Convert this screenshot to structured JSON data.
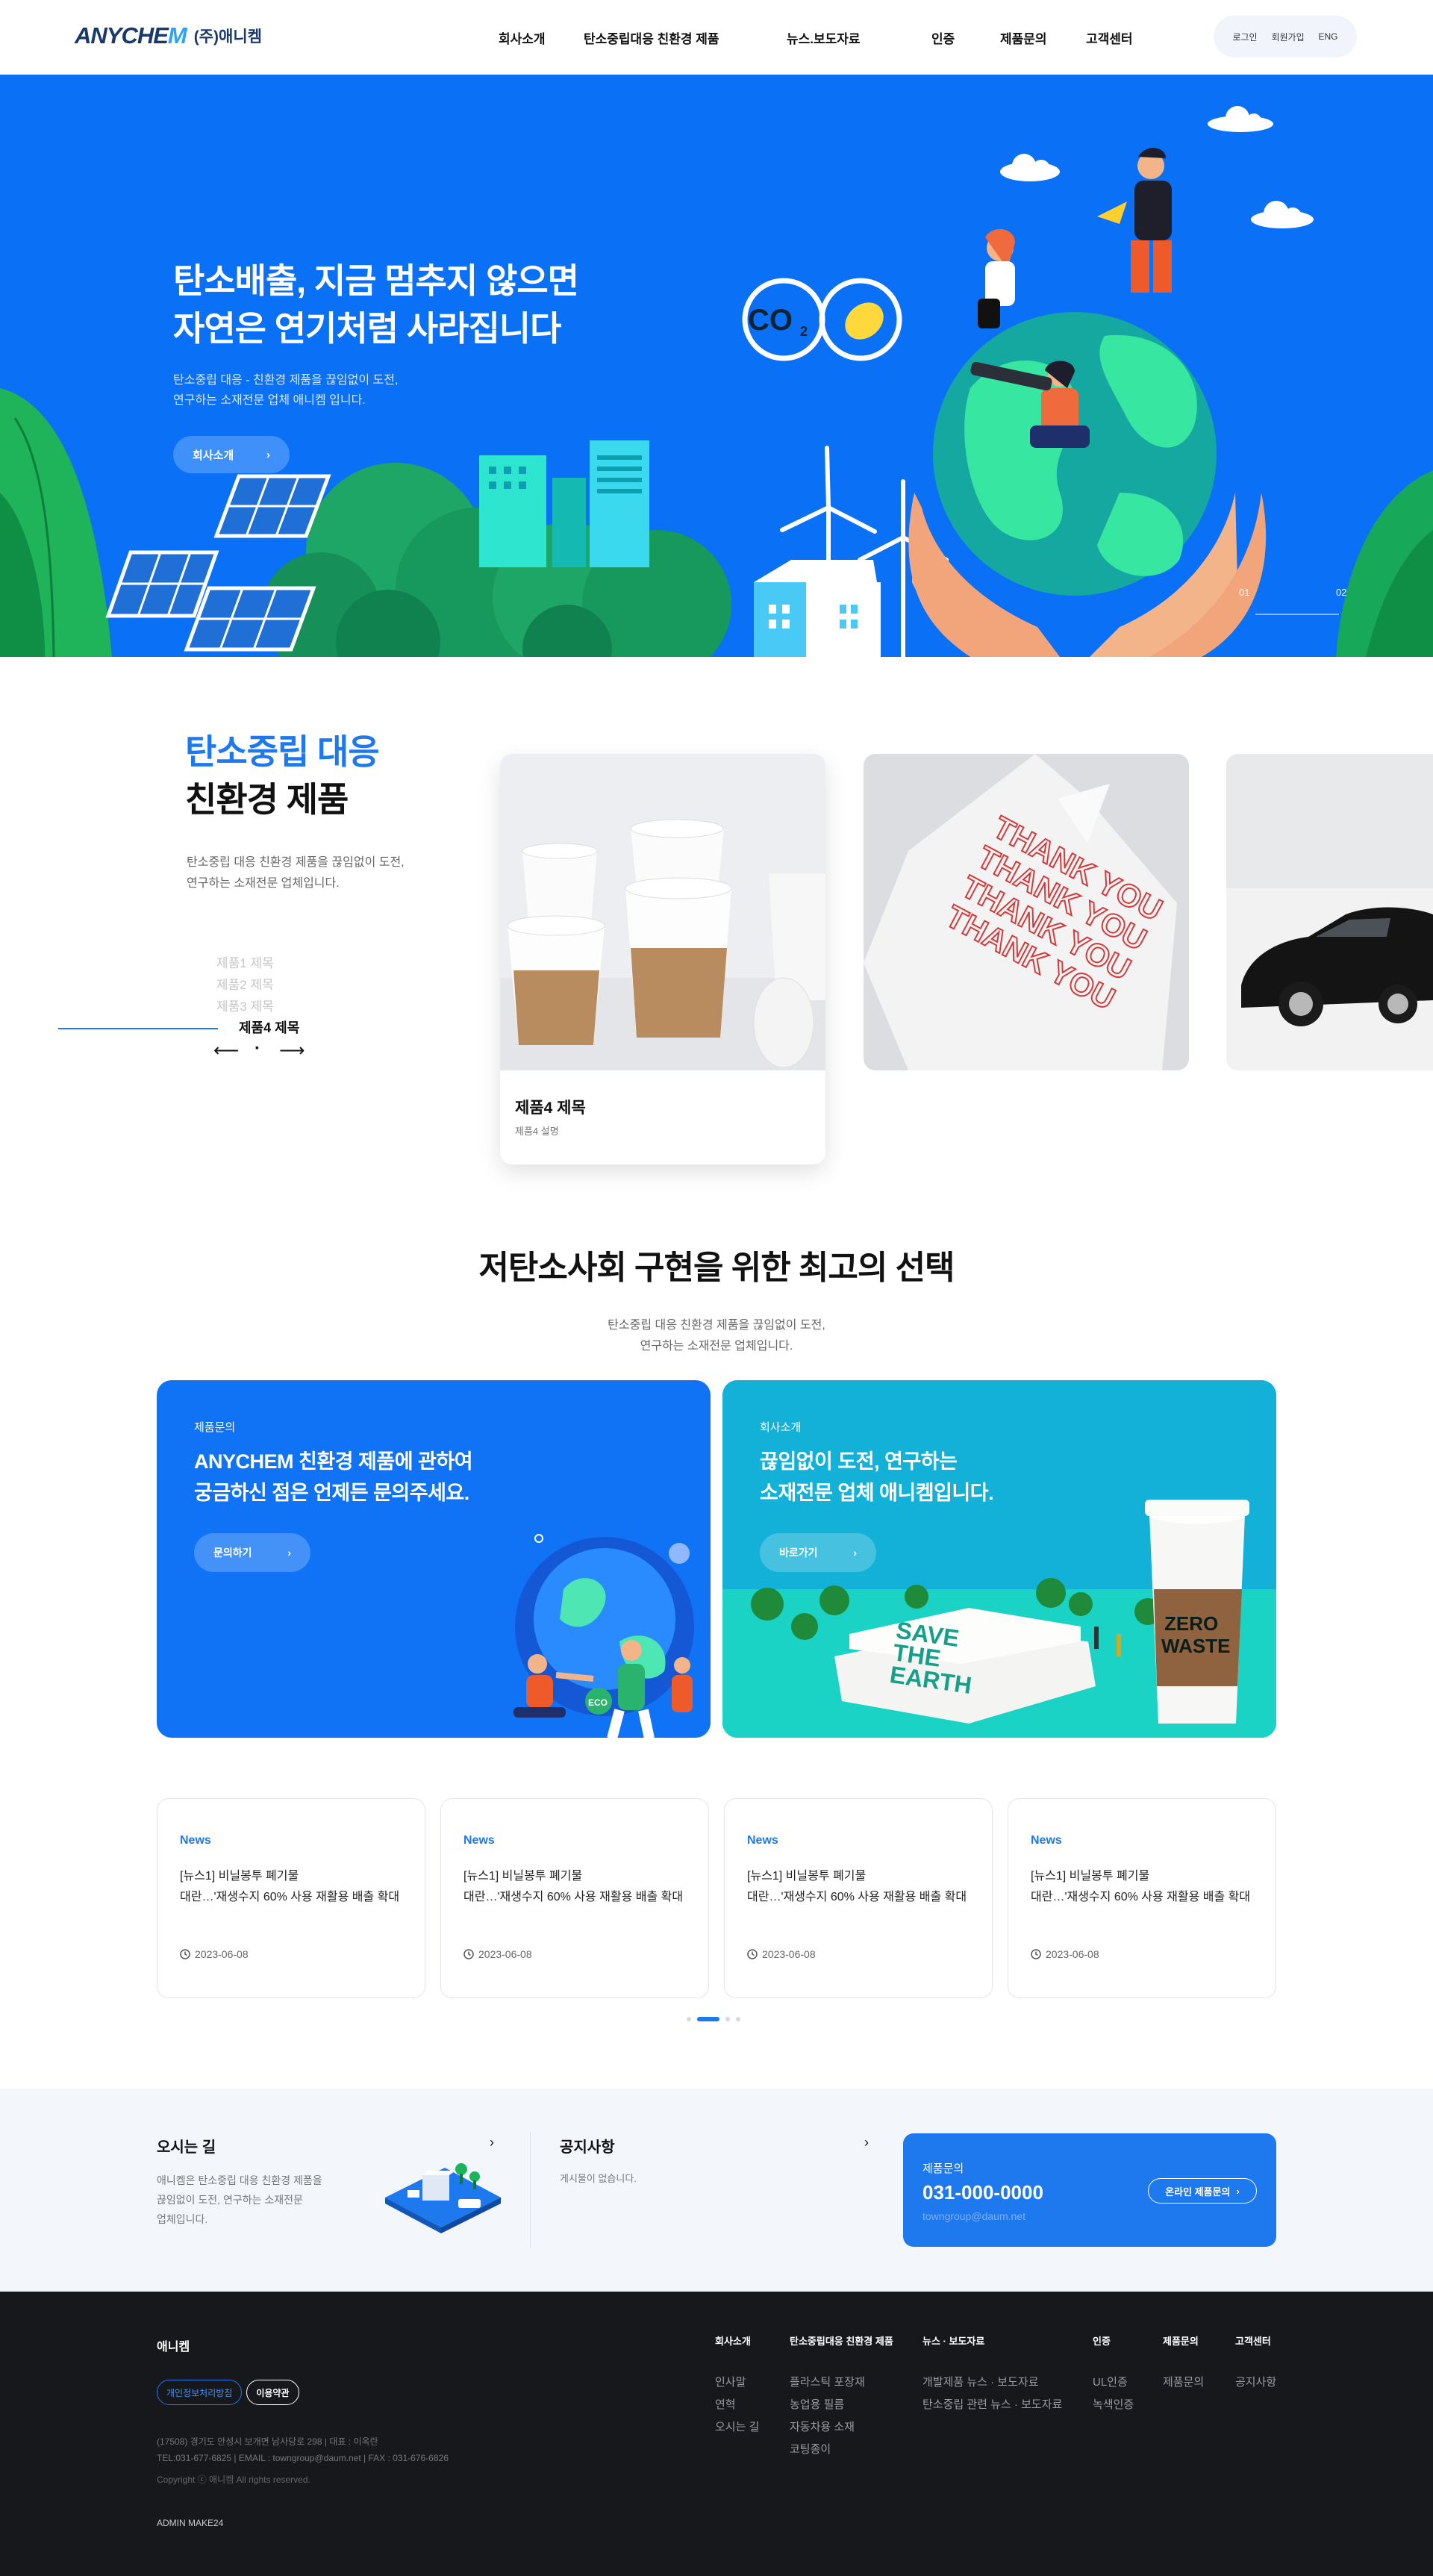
{
  "header": {
    "logo_en_a": "ANYCHE",
    "logo_en_b": "M",
    "logo_ko": "(주)애니켐",
    "nav": [
      "회사소개",
      "탄소중립대응 친환경 제품",
      "뉴스.보도자료",
      "인증",
      "제품문의",
      "고객센터"
    ],
    "util": [
      "로그인",
      "회원가입",
      "ENG"
    ]
  },
  "hero": {
    "title_line1": "탄소배출, 지금 멈추지 않으면",
    "title_line2": "자연은 연기처럼 사라집니다",
    "sub_line1": "탄소중립 대응 - 친환경 제품을 끊임없이 도전,",
    "sub_line2": "연구하는 소재전문 업체 애니켐 입니다.",
    "button": "회사소개",
    "co2_label": "CO",
    "co2_sub": "2",
    "pager": [
      "01",
      "02"
    ]
  },
  "products": {
    "title_blue": "탄소중립 대응",
    "title_black": "친환경 제품",
    "desc_line1": "탄소중립 대응 친환경 제품을 끊임없이 도전,",
    "desc_line2": "연구하는 소재전문 업체입니다.",
    "list": [
      "제품1 제목",
      "제품2 제목",
      "제품3 제목",
      "제품4 제목"
    ],
    "active_card_title": "제품4 제목",
    "active_card_sub": "제품4 설명",
    "bag_text": "THANK YOU"
  },
  "choice": {
    "title": "저탄소사회 구현을 위한 최고의 선택",
    "desc_line1": "탄소중립 대응 친환경 제품을 끊임없이 도전,",
    "desc_line2": "연구하는 소재전문 업체입니다.",
    "left": {
      "label": "제품문의",
      "title_line1": "ANYCHEM 친환경 제품에 관하여",
      "title_line2": "궁금하신 점은 언제든 문의주세요.",
      "button": "문의하기",
      "eco": "ECO"
    },
    "right": {
      "label": "회사소개",
      "title_line1": "끊임없이 도전, 연구하는",
      "title_line2": "소재전문 업체 애니켐입니다.",
      "button": "바로가기",
      "box_text": [
        "SAVE",
        "THE",
        "EARTH"
      ],
      "cup_text": [
        "ZERO",
        "WASTE"
      ]
    }
  },
  "news": [
    {
      "tag": "News",
      "line1": "[뉴스1] 비닐봉투 폐기물",
      "line2": "대란…'재생수지 60% 사용 재활용 배출 확대",
      "date": "2023-06-08"
    },
    {
      "tag": "News",
      "line1": "[뉴스1] 비닐봉투 폐기물",
      "line2": "대란…'재생수지 60% 사용 재활용 배출 확대",
      "date": "2023-06-08"
    },
    {
      "tag": "News",
      "line1": "[뉴스1] 비닐봉투 폐기물",
      "line2": "대란…'재생수지 60% 사용 재활용 배출 확대",
      "date": "2023-06-08"
    },
    {
      "tag": "News",
      "line1": "[뉴스1] 비닐봉투 폐기물",
      "line2": "대란…'재생수지 60% 사용 재활용 배출 확대",
      "date": "2023-06-08"
    }
  ],
  "info": {
    "way_title": "오시는 길",
    "way_desc_line1": "애니켐은 탄소중립 대응 친환경 제품을",
    "way_desc_line2": "끊임없이 도전, 연구하는 소재전문",
    "way_desc_line3": "업체입니다.",
    "notice_title": "공지사항",
    "notice_empty": "게시물이 없습니다.",
    "cs_label": "제품문의",
    "cs_phone": "031-000-0000",
    "cs_email": "towngroup@daum.net",
    "cs_button": "온라인 제품문의"
  },
  "footer": {
    "name": "애니켐",
    "pill1": "개인정보처리방침",
    "pill2": "이용약관",
    "addr_line1": "(17508) 경기도 안성시 보개면 남사당로 298  |  대표 : 이옥란",
    "addr_line2": "TEL:031-677-6825  |  EMAIL : towngroup@daum.net  |  FAX : 031-676-6826",
    "copyright": "Copyright ⓒ 애니켐 All rights reserved.",
    "admin": "ADMIN MAKE24",
    "cols": [
      {
        "head": "회사소개",
        "items": [
          "인사말",
          "연혁",
          "오시는 길"
        ]
      },
      {
        "head": "탄소중립대응 친환경 제품",
        "items": [
          "플라스틱 포장재",
          "농업용 필름",
          "자동차용 소재",
          "코팅종이"
        ]
      },
      {
        "head": "뉴스 · 보도자료",
        "items": [
          "개발제품 뉴스 · 보도자료",
          "탄소중립 관련 뉴스 · 보도자료"
        ]
      },
      {
        "head": "인증",
        "items": [
          "UL인증",
          "녹색인증"
        ]
      },
      {
        "head": "제품문의",
        "items": [
          "제품문의"
        ]
      },
      {
        "head": "고객센터",
        "items": [
          "공지사항"
        ]
      }
    ]
  },
  "colors": {
    "brand_blue": "#0a71f7",
    "accent": "#1e78ee",
    "footer_bg": "#16181c",
    "promo_teal": "#12b0d7"
  }
}
